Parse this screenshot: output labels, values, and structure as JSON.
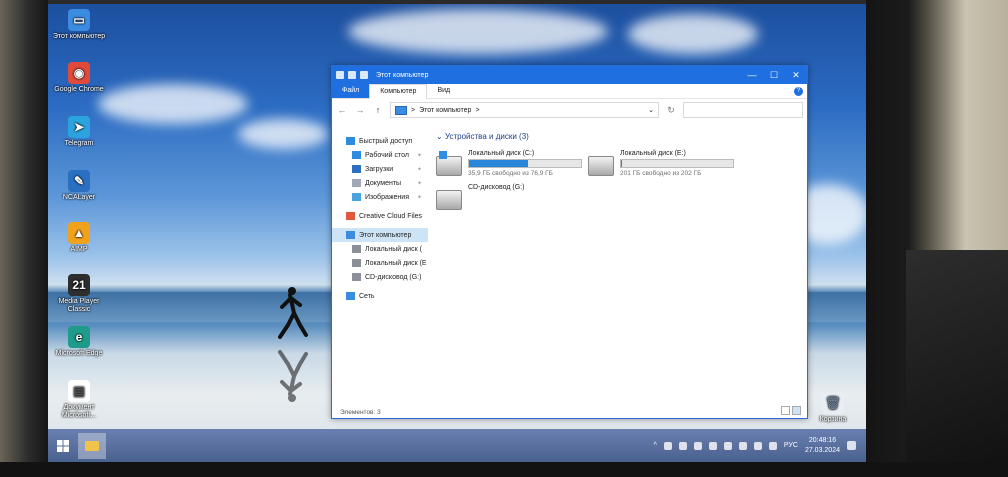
{
  "desktop": {
    "icons": [
      {
        "label": "Этот компьютер",
        "glyph": "▭",
        "color": "#3b8be0"
      },
      {
        "label": "Google Chrome",
        "glyph": "◉",
        "color": "#e04a3b"
      },
      {
        "label": "Telegram",
        "glyph": "➤",
        "color": "#2aa3de"
      },
      {
        "label": "NCALayer",
        "glyph": "✎",
        "color": "#2b6fc2"
      },
      {
        "label": "AIMP",
        "glyph": "▲",
        "color": "#f0a21d"
      },
      {
        "label": "Media Player Classic",
        "glyph": "21",
        "color": "#2e2e2e"
      },
      {
        "label": "Microsoft Edge",
        "glyph": "e",
        "color": "#1e9b8a"
      },
      {
        "label": "Документ Microsoft...",
        "glyph": "▤",
        "color": "#ffffff"
      }
    ],
    "recycle_bin_label": "Корзина"
  },
  "explorer": {
    "title": "Этот компьютер",
    "ribbon_tabs": [
      "Файл",
      "Компьютер",
      "Вид"
    ],
    "address_path": "Этот компьютер",
    "address_separator": ">",
    "nav_back": "←",
    "nav_forward": "→",
    "nav_up": "↑",
    "refresh": "↻",
    "help": "?",
    "window_controls": {
      "minimize": "—",
      "maximize": "☐",
      "close": "✕"
    },
    "sidebar": [
      {
        "label": "Быстрый доступ",
        "icon": "star-icon",
        "color": "#2d8be0",
        "pinned": false,
        "selected": false,
        "indent": 0
      },
      {
        "label": "Рабочий стол",
        "icon": "desktop-icon",
        "color": "#2d8be0",
        "pinned": true,
        "selected": false,
        "indent": 1
      },
      {
        "label": "Загрузки",
        "icon": "download-icon",
        "color": "#2d6fc2",
        "pinned": true,
        "selected": false,
        "indent": 1
      },
      {
        "label": "Документы",
        "icon": "documents-icon",
        "color": "#9fa9b8",
        "pinned": true,
        "selected": false,
        "indent": 1
      },
      {
        "label": "Изображения",
        "icon": "pictures-icon",
        "color": "#4aa2e0",
        "pinned": true,
        "selected": false,
        "indent": 1
      },
      {
        "label": "Creative Cloud Files",
        "icon": "creative-cloud-icon",
        "color": "#e0593b",
        "pinned": false,
        "selected": false,
        "indent": 0
      },
      {
        "label": "Этот компьютер",
        "icon": "computer-icon",
        "color": "#3b8be0",
        "pinned": false,
        "selected": true,
        "indent": 0
      },
      {
        "label": "Локальный диск (",
        "icon": "drive-icon",
        "color": "#8a8f99",
        "pinned": false,
        "selected": false,
        "indent": 1
      },
      {
        "label": "Локальный диск (E",
        "icon": "drive-icon",
        "color": "#8a8f99",
        "pinned": false,
        "selected": false,
        "indent": 1
      },
      {
        "label": "CD-дисковод (G:)",
        "icon": "cd-drive-icon",
        "color": "#8a8f99",
        "pinned": false,
        "selected": false,
        "indent": 1
      },
      {
        "label": "Сеть",
        "icon": "network-icon",
        "color": "#3b8be0",
        "pinned": false,
        "selected": false,
        "indent": 0
      }
    ],
    "group_heading": "Устройства и диски (3)",
    "drives": [
      {
        "name": "Локальный диск (C:)",
        "free_text": "35,9 ГБ свободно из 76,9 ГБ",
        "used_fraction": 0.53,
        "system": true
      },
      {
        "name": "Локальный диск (E:)",
        "free_text": "201 ГБ свободно из 202 ГБ",
        "used_fraction": 0.005,
        "system": false
      },
      {
        "name": "CD-дисковод (G:)",
        "free_text": "",
        "used_fraction": null,
        "system": false
      }
    ],
    "status_text": "Элементов: 3"
  },
  "taskbar": {
    "language": "РУС",
    "time": "20:48:16",
    "date": "27.03.2024"
  }
}
